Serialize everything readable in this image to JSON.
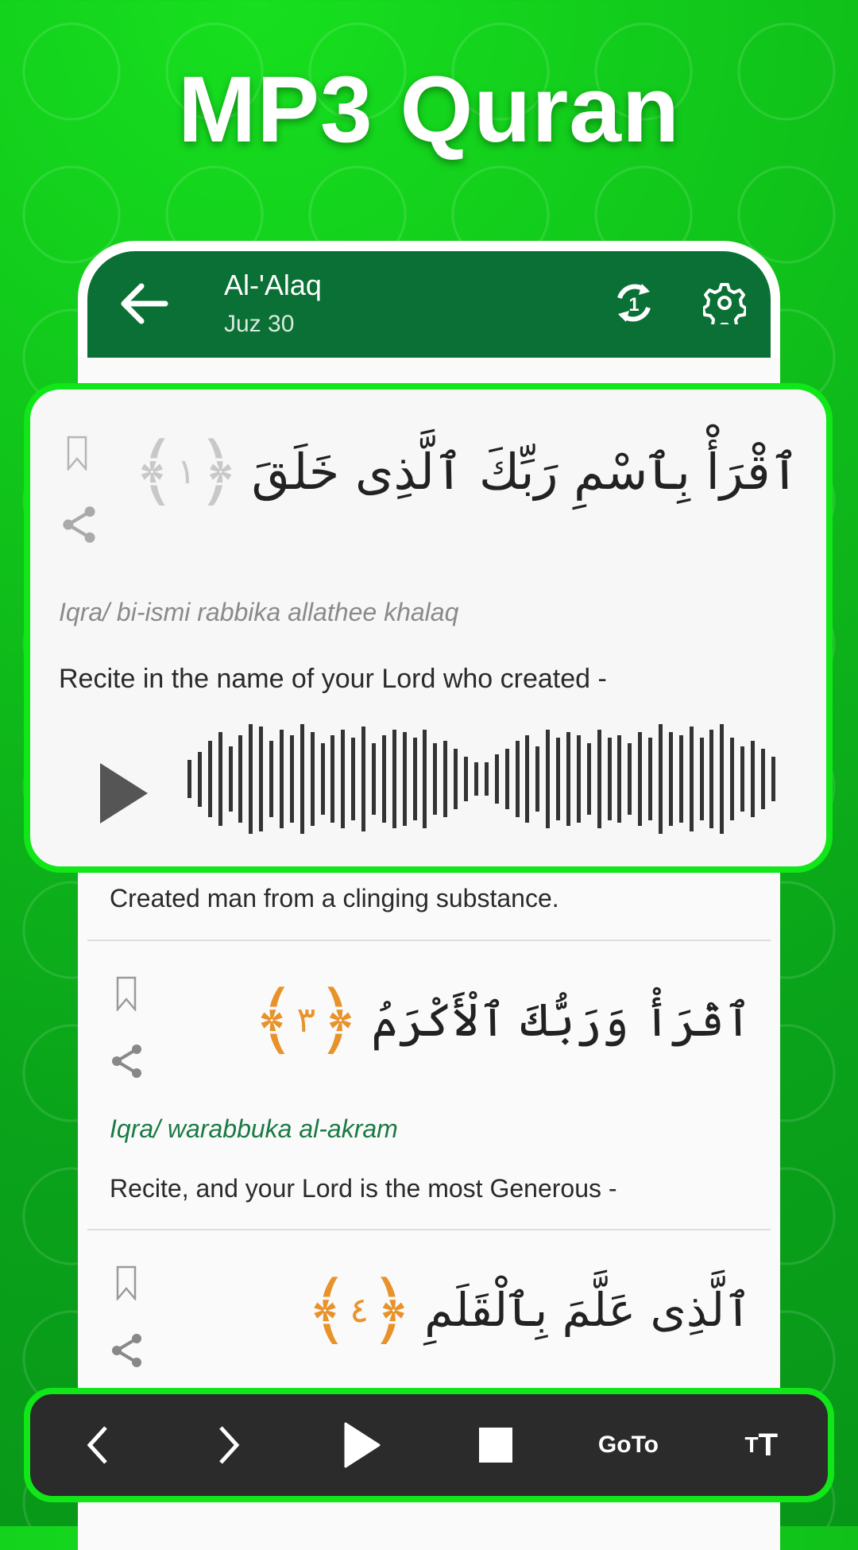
{
  "promo_title": "MP3 Quran",
  "colors": {
    "brand_green": "#0b7035",
    "highlight_border": "#11e619",
    "marker_orange": "#e8922a",
    "translit_green": "#1a7a45",
    "bar_bg": "#2b2b2b"
  },
  "header": {
    "title": "Al-'Alaq",
    "subtitle": "Juz 30",
    "back_icon": "arrow-left-icon",
    "repeat_icon": "repeat-one-icon",
    "settings_icon": "gear-icon"
  },
  "verses": [
    {
      "number": "١",
      "arabic": "ٱقْرَأْ بِٱسْمِ رَبِّكَ ٱلَّذِى خَلَقَ",
      "transliteration": "Iqra/ bi-ismi rabbika allathee khalaq",
      "translation": "Recite in the name of your Lord who created -",
      "playing": true
    },
    {
      "translation": "Created man from a clinging substance."
    },
    {
      "number": "٣",
      "arabic": "ٱقْرَأْ وَرَبُّكَ ٱلْأَكْرَمُ",
      "transliteration": "Iqra/ warabbuka al-akram",
      "translation": "Recite, and your Lord is the most Generous -"
    },
    {
      "number": "٤",
      "arabic": "ٱلَّذِى عَلَّمَ بِٱلْقَلَمِ"
    }
  ],
  "bottom_bar": {
    "prev_icon": "chevron-left-icon",
    "next_icon": "chevron-right-icon",
    "play_icon": "play-icon",
    "stop_icon": "stop-icon",
    "goto_label": "GoTo",
    "text_size_label_small": "T",
    "text_size_label_large": "T"
  }
}
